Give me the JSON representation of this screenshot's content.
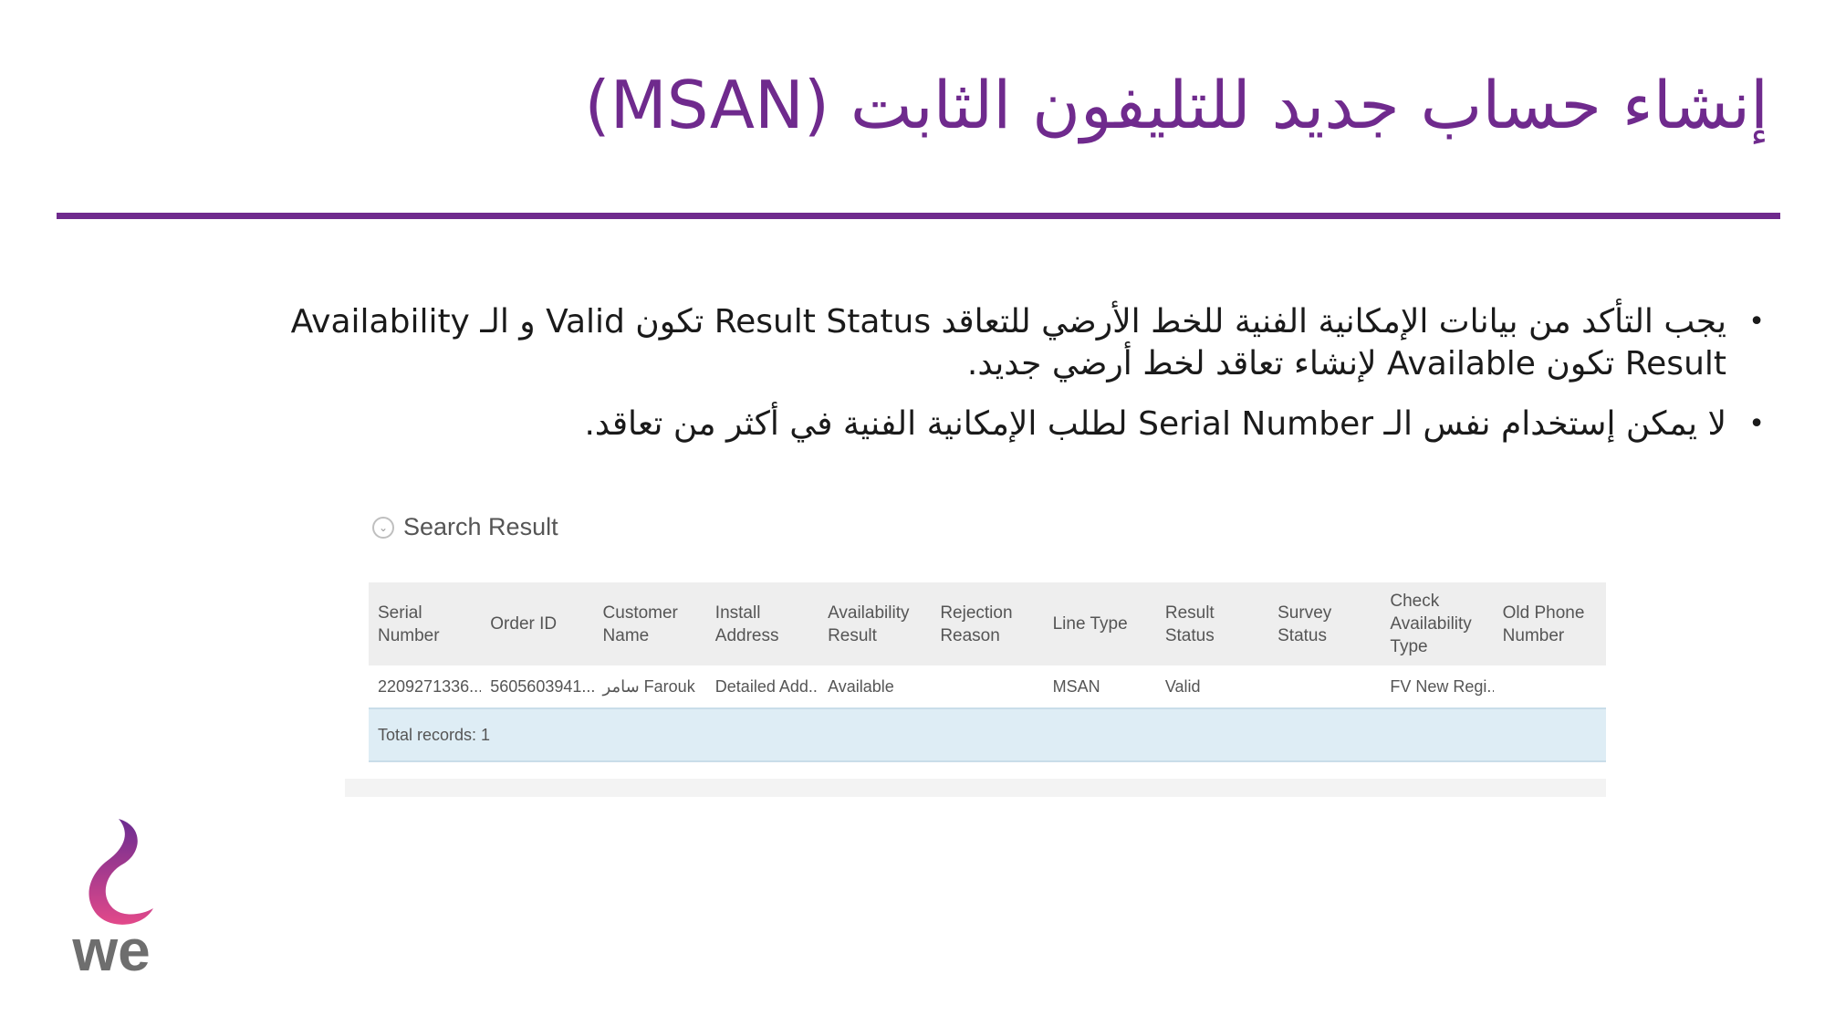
{
  "title": "إنشاء حساب جديد للتليفون الثابت (MSAN)",
  "bullets": [
    "يجب التأكد من بيانات الإمكانية الفنية للخط الأرضي للتعاقد Result Status تكون Valid و الـ Availability Result تكون Available لإنشاء تعاقد لخط أرضي جديد.",
    "لا يمكن إستخدام نفس الـ Serial Number لطلب الإمكانية الفنية في أكثر من تعاقد."
  ],
  "bullet_symbol": "•",
  "search_panel": {
    "label": "Search Result",
    "toggle_icon": "chevron-down-icon",
    "columns": [
      "Serial Number",
      "Order ID",
      "Customer Name",
      "Install Address",
      "Availability Result",
      "Rejection Reason",
      "Line Type",
      "Result Status",
      "Survey Status",
      "Check Availability Type",
      "Old Phone Number"
    ],
    "rows": [
      {
        "cells": [
          "2209271336...",
          "5605603941...",
          "سامر Farouk",
          "Detailed Add...",
          "Available",
          "",
          "MSAN",
          "Valid",
          "",
          "FV New Regi...",
          ""
        ]
      }
    ],
    "footer": "Total records: 1"
  },
  "logo": {
    "text": "we",
    "colors": {
      "swoosh_top": "#6b2c91",
      "swoosh_bottom": "#e2498a",
      "text": "#6e6e6e"
    }
  },
  "colors": {
    "accent": "#6f2a8d",
    "body_text": "#1a1a1a",
    "table_header_bg": "#eeeeee",
    "table_footer_bg": "#deedf5"
  }
}
